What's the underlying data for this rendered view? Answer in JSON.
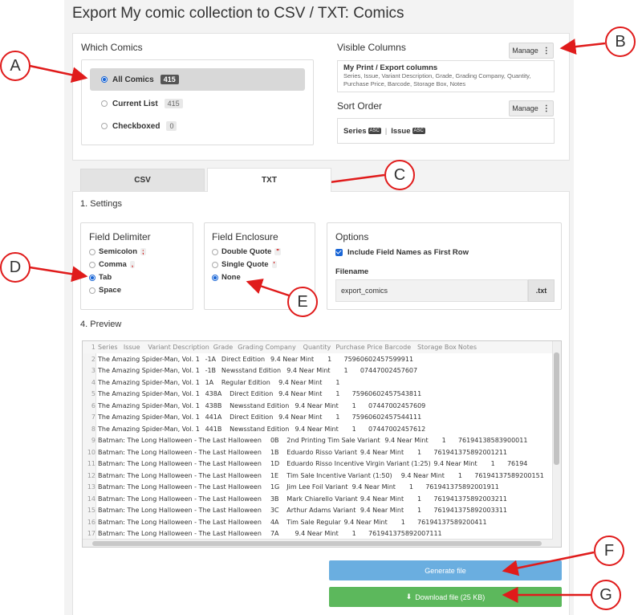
{
  "page": {
    "title": "Export My comic collection to CSV / TXT: Comics"
  },
  "which_comics": {
    "heading": "Which Comics",
    "options": [
      {
        "label": "All Comics",
        "count": "415",
        "selected": true
      },
      {
        "label": "Current List",
        "count": "415",
        "selected": false
      },
      {
        "label": "Checkboxed",
        "count": "0",
        "selected": false
      }
    ]
  },
  "visible_columns": {
    "heading": "Visible Columns",
    "manage_label": "Manage",
    "set_name": "My Print / Export columns",
    "columns_line1": "Series, Issue, Variant Description, Grade, Grading Company, Quantity,",
    "columns_line2": "Purchase Price, Barcode, Storage Box, Notes"
  },
  "sort_order": {
    "heading": "Sort Order",
    "manage_label": "Manage",
    "fields": [
      {
        "label": "Series",
        "dir": "ASC"
      },
      {
        "label": "Issue",
        "dir": "ASC"
      }
    ],
    "separator": "|"
  },
  "tabs": [
    {
      "label": "CSV",
      "active": false
    },
    {
      "label": "TXT",
      "active": true
    }
  ],
  "settings": {
    "heading": "1. Settings",
    "field_delimiter": {
      "heading": "Field Delimiter",
      "options": [
        {
          "label": "Semicolon",
          "symbol": ";",
          "selected": false
        },
        {
          "label": "Comma",
          "symbol": ",",
          "selected": false
        },
        {
          "label": "Tab",
          "symbol": "",
          "selected": true
        },
        {
          "label": "Space",
          "symbol": "",
          "selected": false
        }
      ]
    },
    "field_enclosure": {
      "heading": "Field Enclosure",
      "options": [
        {
          "label": "Double Quote",
          "symbol": "\"",
          "selected": false
        },
        {
          "label": "Single Quote",
          "symbol": "'",
          "selected": false
        },
        {
          "label": "None",
          "symbol": "",
          "selected": true
        }
      ]
    },
    "options": {
      "heading": "Options",
      "include_field_names": "Include Field Names as First Row",
      "include_checked": true,
      "filename_label": "Filename",
      "filename_value": "export_comics",
      "extension": ".txt"
    }
  },
  "preview": {
    "heading": "4. Preview",
    "rows": [
      {
        "n": "1",
        "text": "Series\tIssue\tVariant Description\tGrade\tGrading Company\tQuantity\tPurchase Price\tBarcode\tStorage Box\tNotes"
      },
      {
        "n": "2",
        "text": "The Amazing Spider-Man, Vol. 1\t-1A\tDirect Edition\t9.4 Near Mint\t\t1\t\t75960602457599911"
      },
      {
        "n": "3",
        "text": "The Amazing Spider-Man, Vol. 1\t-1B\tNewsstand Edition\t9.4 Near Mint\t\t1\t\t07447002457607"
      },
      {
        "n": "4",
        "text": "The Amazing Spider-Man, Vol. 1\t1A\tRegular Edition\t9.4 Near Mint\t\t1"
      },
      {
        "n": "5",
        "text": "The Amazing Spider-Man, Vol. 1\t438A\tDirect Edition\t9.4 Near Mint\t\t1\t\t75960602457543811"
      },
      {
        "n": "6",
        "text": "The Amazing Spider-Man, Vol. 1\t438B\tNewsstand Edition\t9.4 Near Mint\t\t1\t\t07447002457609"
      },
      {
        "n": "7",
        "text": "The Amazing Spider-Man, Vol. 1\t441A\tDirect Edition\t9.4 Near Mint\t\t1\t\t75960602457544111"
      },
      {
        "n": "8",
        "text": "The Amazing Spider-Man, Vol. 1\t441B\tNewsstand Edition\t9.4 Near Mint\t\t1\t\t07447002457612"
      },
      {
        "n": "9",
        "text": "Batman: The Long Halloween - The Last Halloween\t0B\t2nd Printing Tim Sale Variant\t9.4 Near Mint\t\t1\t\t76194138583900011"
      },
      {
        "n": "10",
        "text": "Batman: The Long Halloween - The Last Halloween\t1B\tEduardo Risso Variant\t9.4 Near Mint\t\t1\t\t761941375892001211"
      },
      {
        "n": "11",
        "text": "Batman: The Long Halloween - The Last Halloween\t1D\tEduardo Risso Incentive Virgin Variant (1:25)\t9.4 Near Mint\t\t1\t\t76194"
      },
      {
        "n": "12",
        "text": "Batman: The Long Halloween - The Last Halloween\t1E\tTim Sale Incentive Variant (1:50)\t9.4 Near Mint\t\t1\t\t76194137589200151"
      },
      {
        "n": "13",
        "text": "Batman: The Long Halloween - The Last Halloween\t1G\tJim Lee Foil Variant\t9.4 Near Mint\t\t1\t\t761941375892001911"
      },
      {
        "n": "14",
        "text": "Batman: The Long Halloween - The Last Halloween\t3B\tMark Chiarello Variant\t9.4 Near Mint\t\t1\t\t761941375892003211"
      },
      {
        "n": "15",
        "text": "Batman: The Long Halloween - The Last Halloween\t3C\tArthur Adams Variant\t9.4 Near Mint\t\t1\t\t761941375892003311"
      },
      {
        "n": "16",
        "text": "Batman: The Long Halloween - The Last Halloween\t4A\tTim Sale Regular\t9.4 Near Mint\t\t1\t\t76194137589200411"
      },
      {
        "n": "17",
        "text": "Batman: The Long Halloween - The Last Halloween\t7A\t\t9.4 Near Mint\t\t1\t\t761941375892007111"
      }
    ]
  },
  "buttons": {
    "generate": "Generate file",
    "download": "Download file (25 KB)"
  },
  "callouts": [
    "A",
    "B",
    "C",
    "D",
    "E",
    "F",
    "G"
  ],
  "colors": {
    "accent": "#1a66d6",
    "generate_bg": "#6aaee0",
    "download_bg": "#5cb85c",
    "callout_red": "#e01b1b"
  }
}
